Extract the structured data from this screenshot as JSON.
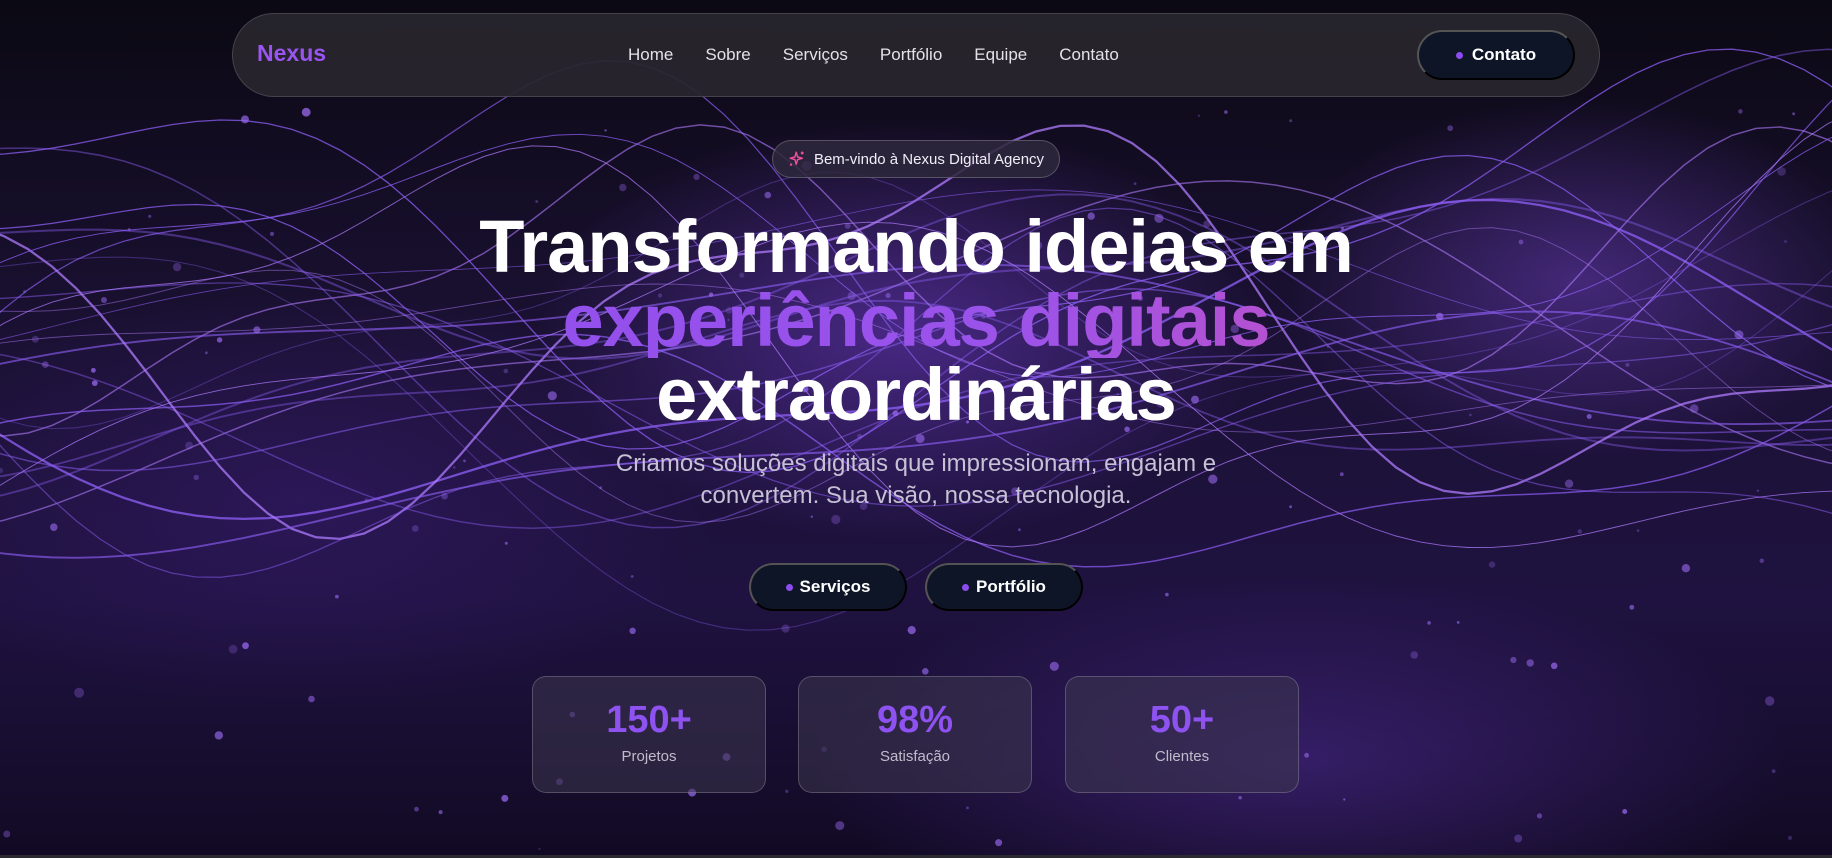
{
  "nav": {
    "logo": "Nexus",
    "links": [
      "Home",
      "Sobre",
      "Serviços",
      "Portfólio",
      "Equipe",
      "Contato"
    ],
    "cta_label": "Contato"
  },
  "hero": {
    "badge_icon": "sparkle-icon",
    "badge_text": "Bem-vindo à Nexus Digital Agency",
    "headline_line1": "Transformando ideias em",
    "headline_line2": "experiências digitais",
    "headline_line3": "extraordinárias",
    "subtitle": "Criamos soluções digitais que impressionam, engajam e convertem. Sua visão, nossa tecnologia.",
    "buttons": [
      "Serviços",
      "Portfólio"
    ]
  },
  "stats": [
    {
      "value": "150+",
      "label": "Projetos"
    },
    {
      "value": "98%",
      "label": "Satisfação"
    },
    {
      "value": "50+",
      "label": "Clientes"
    }
  ],
  "colors": {
    "accent": "#8b4cf0",
    "accent_pink": "#ea4c9c",
    "button_bg": "#0e1526",
    "background": "#07060d"
  }
}
